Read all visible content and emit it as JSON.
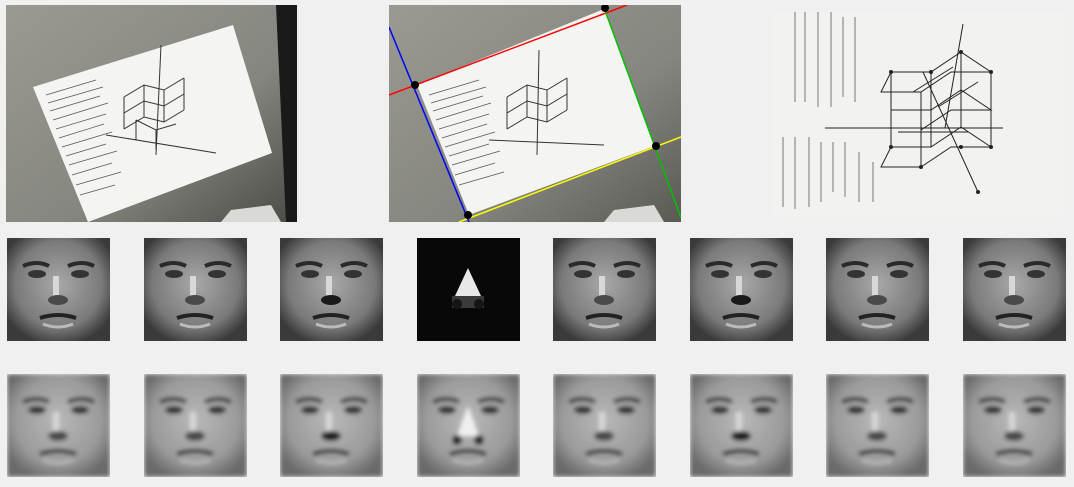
{
  "figure": {
    "top_row": [
      {
        "name": "original-photo"
      },
      {
        "name": "detected-edges"
      },
      {
        "name": "rectified-document"
      }
    ],
    "face_rows": [
      {
        "kind": "raw-face",
        "count": 8
      },
      {
        "kind": "reconstructed-face",
        "count": 8
      }
    ],
    "edge_line_colors": [
      "#ff0000",
      "#00c000",
      "#ffff00",
      "#0000ff"
    ],
    "corner_marker_color": "#000000"
  }
}
